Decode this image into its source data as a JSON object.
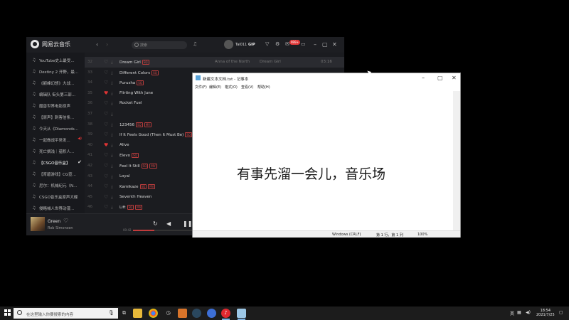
{
  "music_app": {
    "app_name": "网易云音乐",
    "search_placeholder": "搜索",
    "username": "Tai011",
    "vip_label": "GIP",
    "badge": "999+",
    "sidebar": [
      {
        "label": "YouTube史上最受...",
        "active": false
      },
      {
        "label": "Destiny 2 开野，最...",
        "active": false
      },
      {
        "label": "《巅峰幻想》大战...",
        "active": false
      },
      {
        "label": "编辑队 街头第三部...",
        "active": false
      },
      {
        "label": "魔兽世界电影原声",
        "active": false
      },
      {
        "label": "【原声】刺客信条...",
        "active": false
      },
      {
        "label": "今天从《Diamonds...",
        "active": false
      },
      {
        "label": "一起做战平常发...",
        "active": false,
        "marker": "playing"
      },
      {
        "label": "死亡搁浅｜蕴积人...",
        "active": false
      },
      {
        "label": "【CSGO音乐盒】",
        "active": true,
        "marker": "check"
      },
      {
        "label": "【育碧游戏】CG宣...",
        "active": false
      },
      {
        "label": "尼尔：机械纪元（N...",
        "active": false
      },
      {
        "label": "CSGO音乐盒原声大碟",
        "active": false
      },
      {
        "label": "侵略械人世界动漫...",
        "active": false
      }
    ],
    "songs": [
      {
        "num": "32",
        "title": "Dream Girl",
        "tags": [
          "SQ"
        ],
        "artist": "Anna of the North",
        "album": "Dream Girl",
        "dur": "03:16",
        "liked": false,
        "selected": true
      },
      {
        "num": "33",
        "title": "Different Colors",
        "tags": [
          "SQ"
        ],
        "artist": "",
        "album": "",
        "dur": "",
        "liked": false
      },
      {
        "num": "34",
        "title": "Purusha",
        "tags": [
          "SQ"
        ],
        "artist": "",
        "album": "",
        "dur": "",
        "liked": false
      },
      {
        "num": "35",
        "title": "Flirting With June",
        "tags": [],
        "artist": "",
        "album": "",
        "dur": "",
        "liked": true
      },
      {
        "num": "36",
        "title": "Rocket Fuel",
        "tags": [],
        "artist": "",
        "album": "",
        "dur": "",
        "liked": false
      },
      {
        "num": "37",
        "title": "",
        "tags": [],
        "artist": "",
        "album": "",
        "dur": "",
        "liked": false
      },
      {
        "num": "38",
        "title": "123456",
        "tags": [
          "SQ",
          "MV"
        ],
        "artist": "",
        "album": "",
        "dur": "",
        "liked": false
      },
      {
        "num": "39",
        "title": "If It Feels Good (Then It Must Be)",
        "tags": [
          "SQ"
        ],
        "artist": "",
        "album": "",
        "dur": "",
        "liked": false
      },
      {
        "num": "40",
        "title": "Alive",
        "tags": [],
        "artist": "",
        "album": "",
        "dur": "",
        "liked": true
      },
      {
        "num": "41",
        "title": "Elevo",
        "tags": [
          "SQ"
        ],
        "artist": "",
        "album": "",
        "dur": "",
        "liked": false
      },
      {
        "num": "42",
        "title": "Feel It Still",
        "tags": [
          "SQ",
          "MV"
        ],
        "artist": "",
        "album": "",
        "dur": "",
        "liked": false
      },
      {
        "num": "43",
        "title": "Loyal",
        "tags": [],
        "artist": "",
        "album": "",
        "dur": "",
        "liked": false
      },
      {
        "num": "44",
        "title": "Kamikaze",
        "tags": [
          "SQ",
          "MV"
        ],
        "artist": "",
        "album": "",
        "dur": "",
        "liked": false
      },
      {
        "num": "45",
        "title": "Seventh Heaven",
        "tags": [],
        "artist": "",
        "album": "",
        "dur": "",
        "liked": false
      },
      {
        "num": "46",
        "title": "Lift",
        "tags": [
          "SQ",
          "MV"
        ],
        "artist": "",
        "album": "",
        "dur": "",
        "liked": false
      }
    ],
    "player": {
      "title": "Green",
      "artist": "Rob Simonsen",
      "elapsed": "00:42",
      "progress": 0.15
    }
  },
  "notepad": {
    "title": "新建文本文档.txt - 记事本",
    "menu": [
      "文件(F)",
      "编辑(E)",
      "格式(O)",
      "查看(V)",
      "帮助(H)"
    ],
    "content": "有事先溜一会儿，音乐场",
    "status": {
      "encoding": "Windows (CRLF)",
      "position": "第 1 行，第 1 列",
      "zoom": "100%"
    }
  },
  "taskbar": {
    "search_placeholder": "在这里输入你要搜索的内容",
    "tray_ime": "英",
    "time": "18:54",
    "date": "2021/7/25"
  }
}
